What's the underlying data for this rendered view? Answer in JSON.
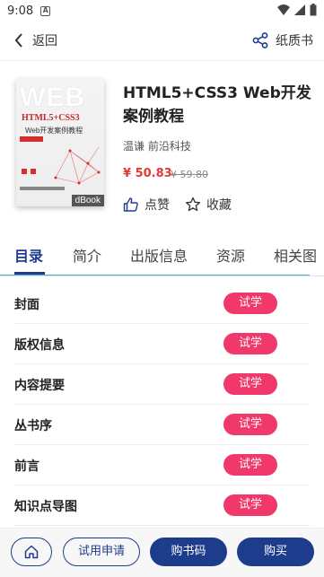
{
  "status": {
    "time": "9:08",
    "badge": "A"
  },
  "topbar": {
    "back_label": "返回",
    "paper_label": "纸质书"
  },
  "book": {
    "cover_big": "WEB",
    "cover_title": "HTML5+CSS3",
    "cover_subtitle": "Web开发案例教程",
    "dbook_label": "dBook",
    "title": "HTML5+CSS3 Web开发案例教程",
    "authors": "温谦 前沿科技",
    "price": "¥ 50.83",
    "original_price": "¥ 59.80",
    "like_label": "点赞",
    "favorite_label": "收藏"
  },
  "tabs": [
    "目录",
    "简介",
    "出版信息",
    "资源",
    "相关图"
  ],
  "toc": [
    {
      "label": "封面",
      "action": "试学"
    },
    {
      "label": "版权信息",
      "action": "试学"
    },
    {
      "label": "内容提要",
      "action": "试学"
    },
    {
      "label": "丛书序",
      "action": "试学"
    },
    {
      "label": "前言",
      "action": "试学"
    },
    {
      "label": "知识点导图",
      "action": "试学"
    }
  ],
  "bottom": {
    "apply_label": "试用申请",
    "code_label": "购书码",
    "buy_label": "购买"
  },
  "colors": {
    "accent": "#1e3c8c",
    "trial": "#f0386a",
    "price": "#e53935"
  }
}
